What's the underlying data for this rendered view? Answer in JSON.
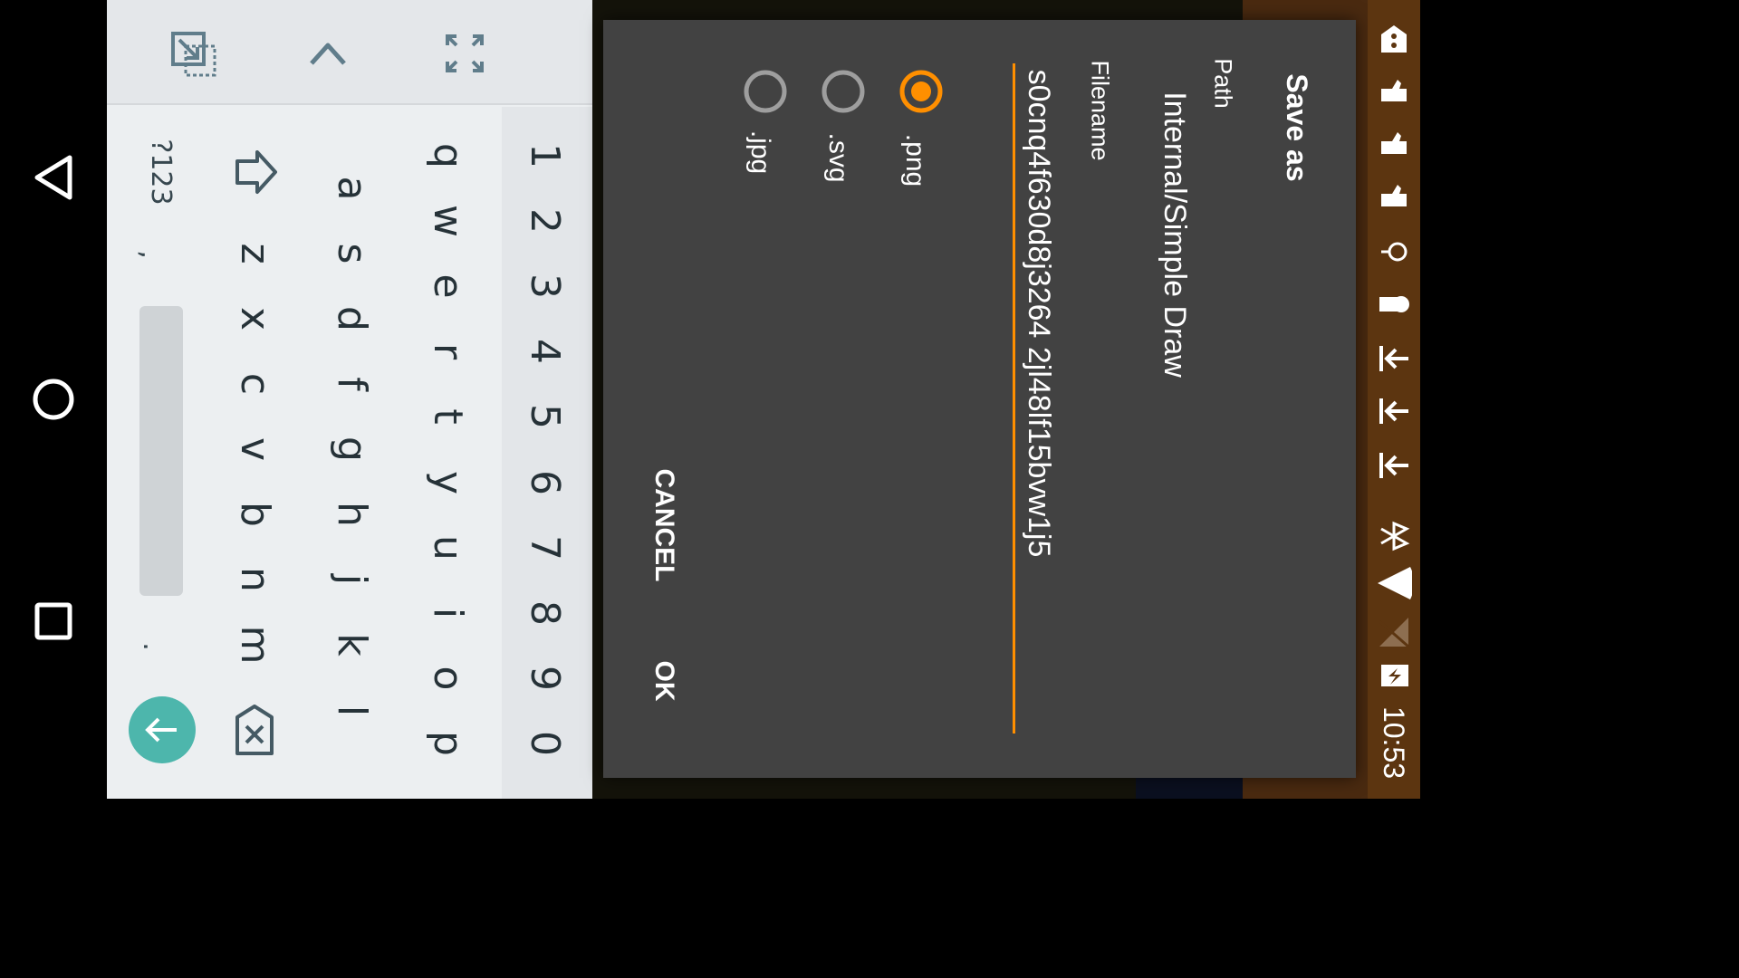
{
  "dialog": {
    "title": "Save as",
    "path_label": "Path",
    "path_value": "Internal/Simple Draw",
    "filename_label": "Filename",
    "filename_value": "s0cnq4f630d8j3264 2jl48lf15bvw1j5",
    "formats": [
      {
        "label": ".png",
        "selected": true
      },
      {
        "label": ".svg",
        "selected": false
      },
      {
        "label": ".jpg",
        "selected": false
      }
    ],
    "cancel_label": "CANCEL",
    "ok_label": "OK",
    "accent_color": "#ff8f00"
  },
  "keyboard": {
    "number_row": [
      "1",
      "2",
      "3",
      "4",
      "5",
      "6",
      "7",
      "8",
      "9",
      "0"
    ],
    "row1": [
      "q",
      "w",
      "e",
      "r",
      "t",
      "y",
      "u",
      "i",
      "o",
      "p"
    ],
    "row2": [
      "a",
      "s",
      "d",
      "f",
      "g",
      "h",
      "j",
      "k",
      "l"
    ],
    "row3": [
      "z",
      "x",
      "c",
      "v",
      "b",
      "n",
      "m"
    ],
    "symbols_label": "?123",
    "comma": ",",
    "period": ".",
    "accent_color": "#4db6ac"
  },
  "statusbar": {
    "time": "10:53"
  }
}
